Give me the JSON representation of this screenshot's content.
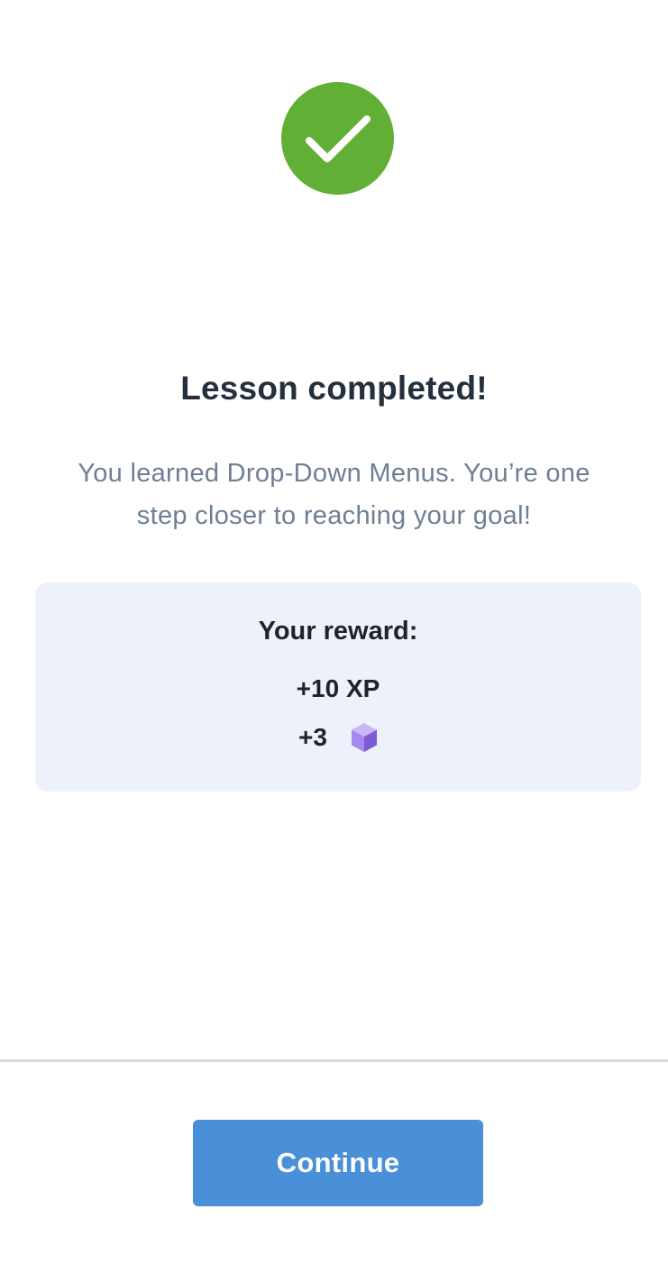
{
  "colors": {
    "success_green": "#62af36",
    "reward_card_bg": "#edf1fa",
    "button_blue": "#4a90d9",
    "gem_purple": "#8a6ae0"
  },
  "icons": {
    "success": "checkmark-icon",
    "gem": "gem-cube-icon"
  },
  "completion": {
    "title": "Lesson completed!",
    "message": "You learned Drop-Down Menus. You’re one step closer to reaching your goal!"
  },
  "reward": {
    "heading": "Your reward:",
    "xp": "+10 XP",
    "gems": "+3"
  },
  "footer": {
    "continue_label": "Continue"
  }
}
